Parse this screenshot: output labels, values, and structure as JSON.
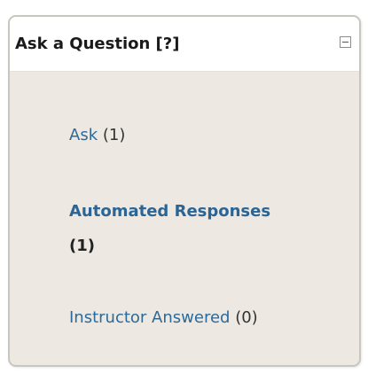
{
  "panel": {
    "title": "Ask a Question [?]",
    "collapse_icon": "minus-box-icon"
  },
  "links": [
    {
      "label": "Ask",
      "count": "(1)"
    },
    {
      "label": "Automated Responses",
      "count": "(1)"
    },
    {
      "label": "Instructor Answered",
      "count": "(0)"
    }
  ],
  "colors": {
    "link": "#2b6a9b",
    "panel_bg": "#ede8e1",
    "header_bg": "#ffffff"
  }
}
